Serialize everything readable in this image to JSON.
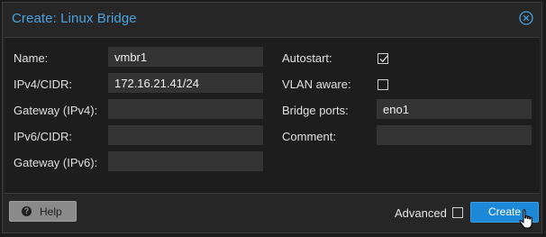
{
  "dialog": {
    "title": "Create: Linux Bridge",
    "close_icon": "close-circle-icon"
  },
  "form": {
    "name": {
      "label": "Name:",
      "value": "vmbr1"
    },
    "ipv4_cidr": {
      "label": "IPv4/CIDR:",
      "value": "172.16.21.41/24"
    },
    "gateway_ipv4": {
      "label": "Gateway (IPv4):",
      "value": ""
    },
    "ipv6_cidr": {
      "label": "IPv6/CIDR:",
      "value": ""
    },
    "gateway_ipv6": {
      "label": "Gateway (IPv6):",
      "value": ""
    },
    "autostart": {
      "label": "Autostart:",
      "checked": true
    },
    "vlan_aware": {
      "label": "VLAN aware:",
      "checked": false
    },
    "bridge_ports": {
      "label": "Bridge ports:",
      "value": "eno1"
    },
    "comment": {
      "label": "Comment:",
      "value": ""
    }
  },
  "footer": {
    "help_label": "Help",
    "help_icon": "question-circle-icon",
    "advanced_label": "Advanced",
    "advanced_checked": false,
    "create_label": "Create"
  },
  "colors": {
    "title": "#4aa3df",
    "accent": "#1e88d8",
    "dialog_bg": "#262626",
    "body_bg": "#1d1d1d",
    "field_bg": "#333333"
  }
}
